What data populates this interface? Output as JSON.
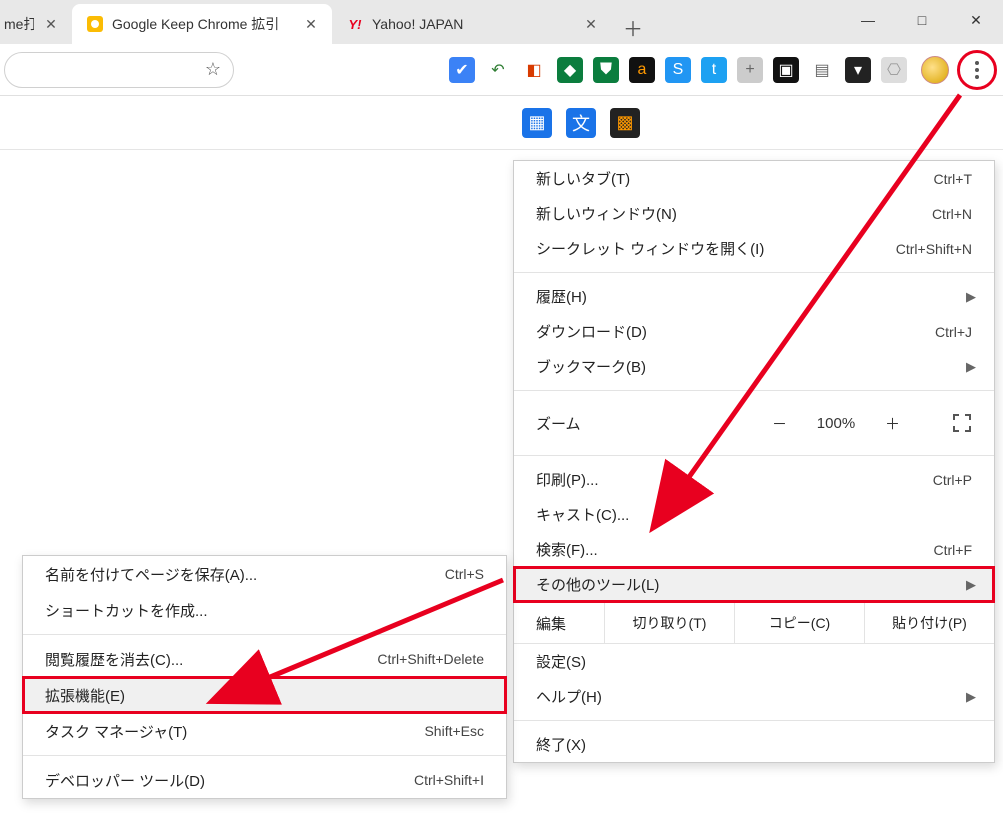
{
  "tabs": {
    "partial": {
      "label": "me打"
    },
    "active": {
      "label": "Google Keep Chrome 拡引"
    },
    "inactive": {
      "label": "Yahoo! JAPAN"
    }
  },
  "extensions_row1": [
    {
      "name": "check-icon",
      "glyph": "✔",
      "bg": "#3b82f6",
      "fg": "#fff"
    },
    {
      "name": "reply-icon",
      "glyph": "↶",
      "bg": "transparent",
      "fg": "#2e7d32"
    },
    {
      "name": "office-icon",
      "glyph": "◧",
      "bg": "transparent",
      "fg": "#d83b01"
    },
    {
      "name": "shield-icon",
      "glyph": "◆",
      "bg": "#0b7d3e",
      "fg": "#fff"
    },
    {
      "name": "shield-check-icon",
      "glyph": "⛊",
      "bg": "#0b7d3e",
      "fg": "#fff"
    },
    {
      "name": "amazon-icon",
      "glyph": "a",
      "bg": "#111",
      "fg": "#ff9900"
    },
    {
      "name": "s-icon",
      "glyph": "S",
      "bg": "#2196f3",
      "fg": "#fff"
    },
    {
      "name": "twitter-icon",
      "glyph": "t",
      "bg": "#1da1f2",
      "fg": "#fff"
    },
    {
      "name": "plus-box-icon",
      "glyph": "+",
      "bg": "#ccc",
      "fg": "#666"
    },
    {
      "name": "pip-icon",
      "glyph": "▣",
      "bg": "#111",
      "fg": "#fff"
    },
    {
      "name": "page-icon",
      "glyph": "▤",
      "bg": "transparent",
      "fg": "#666"
    },
    {
      "name": "pocket-icon",
      "glyph": "▾",
      "bg": "#222",
      "fg": "#fff"
    },
    {
      "name": "location-icon",
      "glyph": "⎔",
      "bg": "#ddd",
      "fg": "#999"
    }
  ],
  "extensions_row2": [
    {
      "name": "qr-icon",
      "glyph": "▦",
      "bg": "#1a73e8",
      "fg": "#fff"
    },
    {
      "name": "translate-icon",
      "glyph": "文",
      "bg": "#1a73e8",
      "fg": "#fff"
    },
    {
      "name": "image-search-icon",
      "glyph": "▩",
      "bg": "#222",
      "fg": "#ff9900"
    }
  ],
  "main_menu": {
    "new_tab": {
      "label": "新しいタブ(T)",
      "shortcut": "Ctrl+T"
    },
    "new_window": {
      "label": "新しいウィンドウ(N)",
      "shortcut": "Ctrl+N"
    },
    "incognito": {
      "label": "シークレット ウィンドウを開く(I)",
      "shortcut": "Ctrl+Shift+N"
    },
    "history": {
      "label": "履歴(H)"
    },
    "downloads": {
      "label": "ダウンロード(D)",
      "shortcut": "Ctrl+J"
    },
    "bookmarks": {
      "label": "ブックマーク(B)"
    },
    "zoom": {
      "label": "ズーム",
      "value": "100%",
      "minus": "－",
      "plus": "＋"
    },
    "print": {
      "label": "印刷(P)...",
      "shortcut": "Ctrl+P"
    },
    "cast": {
      "label": "キャスト(C)..."
    },
    "find": {
      "label": "検索(F)...",
      "shortcut": "Ctrl+F"
    },
    "more_tools": {
      "label": "その他のツール(L)"
    },
    "edit": {
      "label": "編集",
      "cut": "切り取り(T)",
      "copy": "コピー(C)",
      "paste": "貼り付け(P)"
    },
    "settings": {
      "label": "設定(S)"
    },
    "help": {
      "label": "ヘルプ(H)"
    },
    "exit": {
      "label": "終了(X)"
    }
  },
  "submenu": {
    "save_as": {
      "label": "名前を付けてページを保存(A)...",
      "shortcut": "Ctrl+S"
    },
    "create_shortcut": {
      "label": "ショートカットを作成..."
    },
    "clear_history": {
      "label": "閲覧履歴を消去(C)...",
      "shortcut": "Ctrl+Shift+Delete"
    },
    "extensions": {
      "label": "拡張機能(E)"
    },
    "task_manager": {
      "label": "タスク マネージャ(T)",
      "shortcut": "Shift+Esc"
    },
    "dev_tools": {
      "label": "デベロッパー ツール(D)",
      "shortcut": "Ctrl+Shift+I"
    }
  }
}
